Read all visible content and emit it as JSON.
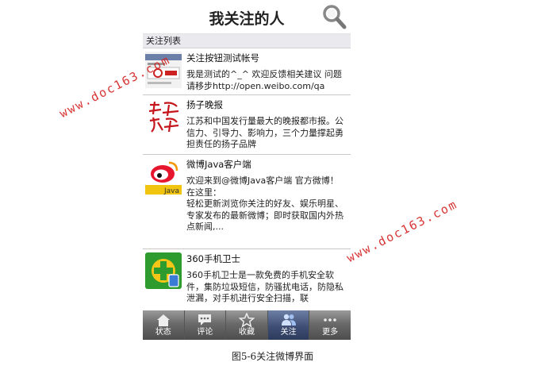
{
  "header": {
    "title": "我关注的人",
    "search_icon": "search-icon"
  },
  "list_header": "关注列表",
  "follows": [
    {
      "name": "关注按钮测试帐号",
      "desc": "我是测试的^_^ 欢迎反馈相关建议 问题请移步http://open.weibo.com/qa",
      "avatar": "screenshot-avatar"
    },
    {
      "name": "扬子晚报",
      "desc": "江苏和中国发行量最大的晚报都市报。公信力、引导力、影响力，三个力量撑起勇担责任的扬子品牌",
      "avatar": "yangtze-evening-news-logo"
    },
    {
      "name": "微博Java客户端",
      "desc": "欢迎来到@微博Java客户端 官方微博！\n在这里：\n轻松更新浏览你关注的好友、娱乐明星、专家发布的最新微博；即时获取国内外热点新闻,...",
      "avatar": "weibo-java-logo"
    },
    {
      "name": "360手机卫士",
      "desc": "360手机卫士是一款免费的手机安全软件，集防垃圾短信，防骚扰电话，防隐私泄漏，对手机进行安全扫描，联",
      "avatar": "360-guard-logo"
    }
  ],
  "tabs": [
    {
      "label": "状态",
      "icon": "home-icon",
      "active": false
    },
    {
      "label": "评论",
      "icon": "comment-icon",
      "active": false
    },
    {
      "label": "收藏",
      "icon": "star-icon",
      "active": false
    },
    {
      "label": "关注",
      "icon": "people-icon",
      "active": true
    },
    {
      "label": "更多",
      "icon": "more-icon",
      "active": false
    }
  ],
  "watermark": "www.doc163.com",
  "caption": "图5-6关注微博界面",
  "colors": {
    "watermark": "#d42020",
    "active_tab": "#3e4e74"
  }
}
